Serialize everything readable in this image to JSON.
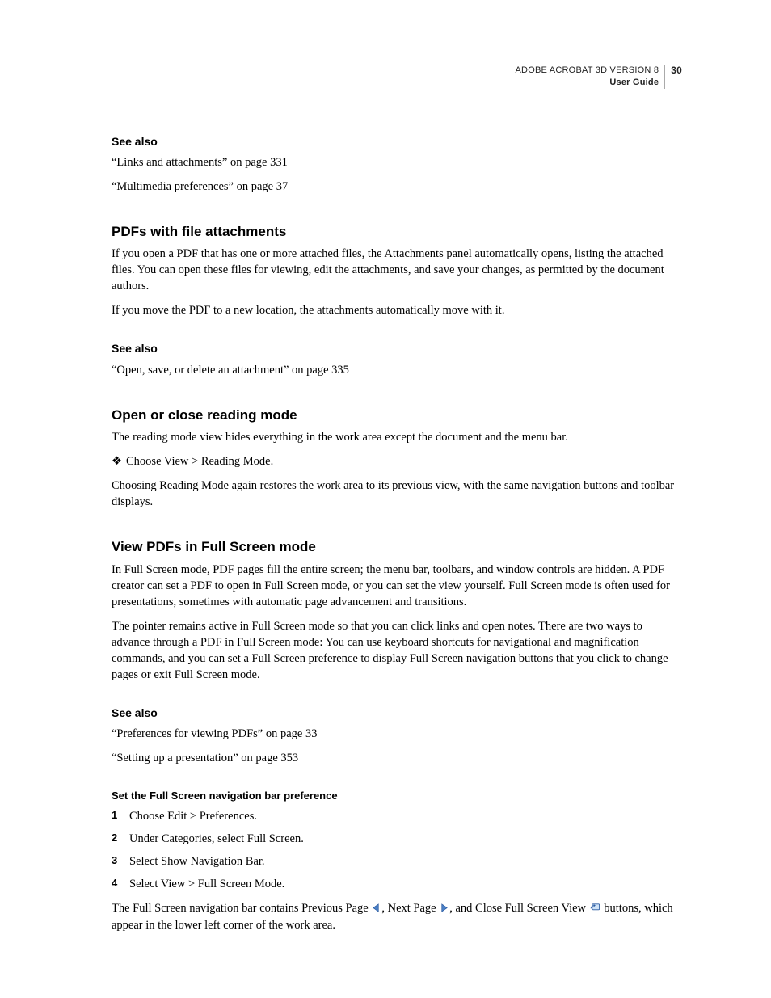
{
  "runhead": {
    "line1": "ADOBE ACROBAT 3D VERSION 8",
    "line2": "User Guide",
    "page": "30"
  },
  "block1": {
    "seeAlso": "See also",
    "refs": [
      "“Links and attachments” on page 331",
      "“Multimedia preferences” on page 37"
    ]
  },
  "pdfsAttach": {
    "title": "PDFs with file attachments",
    "p1": "If you open a PDF that has one or more attached files, the Attachments panel automatically opens, listing the attached files. You can open these files for viewing, edit the attachments, and save your changes, as permitted by the document authors.",
    "p2": "If you move the PDF to a new location, the attachments automatically move with it.",
    "seeAlso": "See also",
    "refs": [
      "“Open, save, or delete an attachment” on page 335"
    ]
  },
  "reading": {
    "title": "Open or close reading mode",
    "p1": "The reading mode view hides everything in the work area except the document and the menu bar.",
    "bullet": "Choose View > Reading Mode.",
    "p2": "Choosing Reading Mode again restores the work area to its previous view, with the same navigation buttons and toolbar displays."
  },
  "fullscreen": {
    "title": "View PDFs in Full Screen mode",
    "p1": "In Full Screen mode, PDF pages fill the entire screen; the menu bar, toolbars, and window controls are hidden. A PDF creator can set a PDF to open in Full Screen mode, or you can set the view yourself. Full Screen mode is often used for presentations, sometimes with automatic page advancement and transitions.",
    "p2": "The pointer remains active in Full Screen mode so that you can click links and open notes. There are two ways to advance through a PDF in Full Screen mode: You can use keyboard shortcuts for navigational and magnification commands, and you can set a Full Screen preference to display Full Screen navigation buttons that you click to change pages or exit Full Screen mode.",
    "seeAlso": "See also",
    "refs": [
      "“Preferences for viewing PDFs” on page 33",
      "“Setting up a presentation” on page 353"
    ],
    "subhead": "Set the Full Screen navigation bar preference",
    "steps": [
      "Choose Edit > Preferences.",
      "Under Categories, select Full Screen.",
      "Select Show Navigation Bar.",
      "Select View > Full Screen Mode."
    ],
    "tail_a": "The Full Screen navigation bar contains Previous Page ",
    "tail_b": ", Next Page ",
    "tail_c": ", and Close Full Screen View ",
    "tail_d": " buttons, which appear in the lower left corner of the work area."
  }
}
